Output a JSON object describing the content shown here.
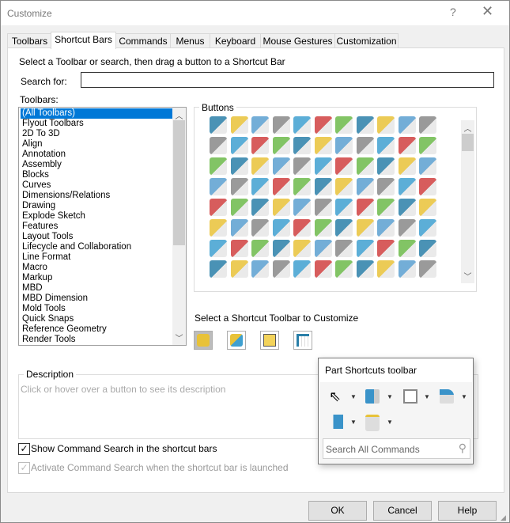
{
  "window": {
    "title": "Customize",
    "help_glyph": "?",
    "close_glyph": "✕"
  },
  "tabs": [
    {
      "label": "Toolbars",
      "active": false
    },
    {
      "label": "Shortcut Bars",
      "active": true
    },
    {
      "label": "Commands",
      "active": false
    },
    {
      "label": "Menus",
      "active": false
    },
    {
      "label": "Keyboard",
      "active": false
    },
    {
      "label": "Mouse Gestures",
      "active": false
    },
    {
      "label": "Customization",
      "active": false
    }
  ],
  "instruction": "Select a Toolbar or search, then drag a button to a Shortcut Bar",
  "search": {
    "label": "Search for:",
    "value": ""
  },
  "toolbars": {
    "label": "Toolbars:",
    "selected": "(All Toolbars)",
    "items": [
      "(All Toolbars)",
      "Flyout Toolbars",
      "2D To 3D",
      "Align",
      "Annotation",
      "Assembly",
      "Blocks",
      "Curves",
      "Dimensions/Relations",
      "Drawing",
      "Explode Sketch",
      "Features",
      "Layout Tools",
      "Lifecycle and Collaboration",
      "Line Format",
      "Macro",
      "Markup",
      "MBD",
      "MBD Dimension",
      "Mold Tools",
      "Quick Snaps",
      "Reference Geometry",
      "Render Tools"
    ]
  },
  "buttons": {
    "label": "Buttons",
    "icons": [
      [
        "reference-geometry-icon",
        "align-left-icon",
        "font-icon",
        "part-icon",
        "annotation-note-icon",
        "curve-icon",
        "origin-axes-icon",
        "center-mark-icon",
        "layout-block-icon",
        "move-component-icon",
        "assembly-icon"
      ],
      [
        "text-format-icon",
        "sketch-plane-icon",
        "line-format-icon",
        "script-icon",
        "camera-view-icon",
        "hole-icon",
        "plane-point-icon",
        "appearance-sphere-icon",
        "video-icon",
        "filter-select-icon",
        "window-icon"
      ],
      [
        "display-pane-icon",
        "color-part-icon",
        "grid-sketch-icon",
        "freehand-pen-icon",
        "solidworks-add-icon",
        "spline-icon",
        "save-as-icon",
        "section-view-icon",
        "frame-icon",
        "surface-icon",
        "table-icon"
      ],
      [
        "toolbox-icon",
        "zoom-fit-icon",
        "globe-icon",
        "3d-sketch-icon",
        "extrude-icon",
        "weld-bead-icon",
        "spiral-icon",
        "pipe-icon",
        "routing-icon",
        "tee-fitting-icon",
        "new-document-icon"
      ],
      [
        "open-folder-icon",
        "save-icon",
        "print-icon",
        "options-gear-icon",
        "corner-rect-icon",
        "line-icon",
        "rectangle-icon",
        "slot-icon",
        "circle-icon",
        "arc-icon",
        "ellipse-icon"
      ],
      [
        "spline-curve-icon",
        "fillet-corner-icon",
        "box-icon",
        "trim-icon",
        "convert-entities-icon",
        "linear-pattern-icon",
        "perpendicular-view-icon",
        "dimension-icon",
        "extruded-boss-icon",
        "shell-icon",
        "fillet-icon"
      ],
      [
        "pattern-icon",
        "sheet-metal-icon",
        "insert-part-icon",
        "blocks-icon",
        "mate-icon",
        "hole-wizard-icon",
        "swap-icon",
        "text-styles-icon",
        "monitor-icon",
        "check-icon",
        "fasteners-icon"
      ],
      [
        "insert-component-icon",
        "move-block-icon",
        "cube-icon",
        "render-camera-icon",
        "measure-distance-icon",
        "line-color-icon",
        "move-handle-icon",
        "ruler-icon",
        "color-block-icon",
        "import-icon",
        "image-icon"
      ]
    ]
  },
  "shortcut_select": {
    "label": "Select a Shortcut Toolbar to Customize",
    "options": [
      {
        "name": "part-shortcut-icon",
        "active": true
      },
      {
        "name": "assembly-shortcut-icon",
        "active": false
      },
      {
        "name": "drawing-shortcut-icon",
        "active": false
      },
      {
        "name": "sketch-shortcut-icon",
        "active": false
      }
    ]
  },
  "description": {
    "label": "Description",
    "placeholder": "Click or hover over a button to see its description"
  },
  "checkboxes": [
    {
      "label": "Show Command Search in the shortcut bars",
      "checked": true,
      "enabled": true
    },
    {
      "label": "Activate Command Search when the shortcut bar is launched",
      "checked": true,
      "enabled": false
    }
  ],
  "popup": {
    "title": "Part Shortcuts toolbar",
    "tools": [
      "select-arrow-icon",
      "extruded-boss-icon",
      "shell-icon",
      "fillet-icon",
      "reference-plane-icon",
      "render-camera-icon"
    ],
    "search_placeholder": "Search All Commands"
  },
  "footer": {
    "ok": "OK",
    "cancel": "Cancel",
    "help": "Help"
  },
  "colors": {
    "selection": "#0078d7",
    "icon_blue": "#2a7fa8",
    "icon_yellow": "#e8c238"
  }
}
